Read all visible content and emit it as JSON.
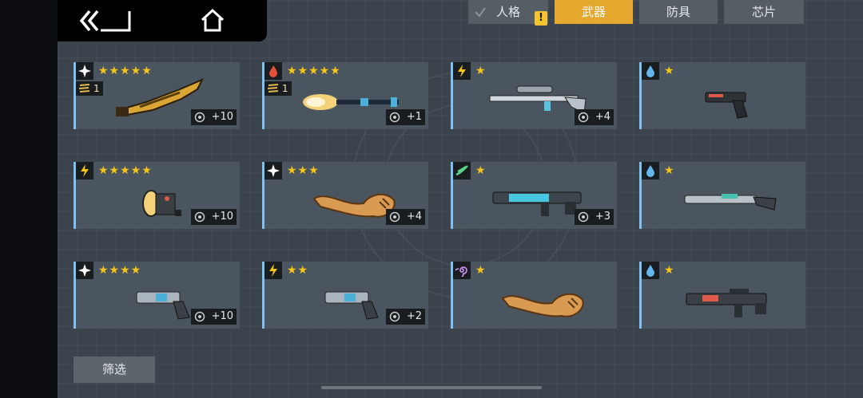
{
  "tabs": [
    {
      "label": "人格",
      "active": false,
      "notice": "!"
    },
    {
      "label": "武器",
      "active": true
    },
    {
      "label": "防具",
      "active": false
    },
    {
      "label": "芯片",
      "active": false
    }
  ],
  "items": [
    {
      "element": "light-icon",
      "stars": "★★★★★",
      "rank": "1",
      "level": "+10",
      "weapon": "golden-blade-icon"
    },
    {
      "element": "fire-icon",
      "stars": "★★★★★",
      "rank": "1",
      "level": "+1",
      "weapon": "brush-staff-icon"
    },
    {
      "element": "lightning-icon",
      "stars": "★",
      "level": "+4",
      "weapon": "sniper-rifle-icon"
    },
    {
      "element": "water-icon",
      "stars": "★",
      "weapon": "pistol-icon"
    },
    {
      "element": "lightning-icon",
      "stars": "★★★★★",
      "level": "+10",
      "weapon": "lantern-gun-icon"
    },
    {
      "element": "light-icon",
      "stars": "★★★",
      "level": "+4",
      "weapon": "flex-arm-icon"
    },
    {
      "element": "wind-icon",
      "stars": "★",
      "level": "+3",
      "weapon": "graffiti-rifle-icon"
    },
    {
      "element": "water-icon",
      "stars": "★",
      "weapon": "shotgun-icon"
    },
    {
      "element": "light-icon",
      "stars": "★★★★",
      "level": "+10",
      "weapon": "revolver-icon"
    },
    {
      "element": "lightning-icon",
      "stars": "★★",
      "level": "+2",
      "weapon": "revolver-icon"
    },
    {
      "element": "void-icon",
      "stars": "★",
      "weapon": "flex-arm-icon"
    },
    {
      "element": "water-icon",
      "stars": "★",
      "weapon": "assault-rifle-icon"
    }
  ],
  "filter_label": "筛选",
  "colors": {
    "accent": "#e4a82e",
    "card": "#4a5560",
    "card_edge": "#7ec1f2",
    "star": "#f5c518"
  }
}
